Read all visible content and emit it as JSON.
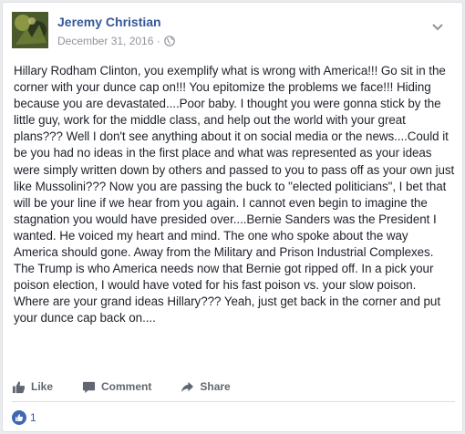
{
  "post": {
    "author": "Jeremy Christian",
    "date": "December 31, 2016 ·",
    "privacy_icon": "globe-icon",
    "menu_icon": "chevron-down-icon",
    "text": "Hillary Rodham Clinton, you exemplify what is wrong with America!!! Go sit in the corner with your dunce cap on!!! You epitomize the problems we face!!! Hiding because you are devastated....Poor baby. I thought you were gonna stick by the little guy, work for the middle class, and help out the world with your great plans??? Well I don't see anything about it on social media or the news....Could it be you had no ideas in the first place and what was represented as your ideas were simply written down by others and passed to you to pass off as your own just like Mussolini??? Now you are passing the buck to \"elected politicians\", I bet that will be your line if we hear from you again. I cannot even begin to imagine the stagnation you would have presided over....Bernie Sanders was the President I wanted. He voiced my heart and mind. The one who spoke about the way America should gone. Away from the Military and Prison Industrial Complexes. The Trump is who America needs now that Bernie got ripped off. In a pick your poison election, I would have voted for his fast poison vs. your slow poison. Where are your grand ideas Hillary??? Yeah, just get back in the corner and put your dunce cap back on...."
  },
  "actions": {
    "like_label": "Like",
    "comment_label": "Comment",
    "share_label": "Share"
  },
  "reactions": {
    "count": "1",
    "icon": "thumbs-up-icon"
  },
  "colors": {
    "link_blue": "#365899",
    "facebook_blue": "#4267b2",
    "gray_text": "#606770",
    "meta_gray": "#90949c"
  }
}
